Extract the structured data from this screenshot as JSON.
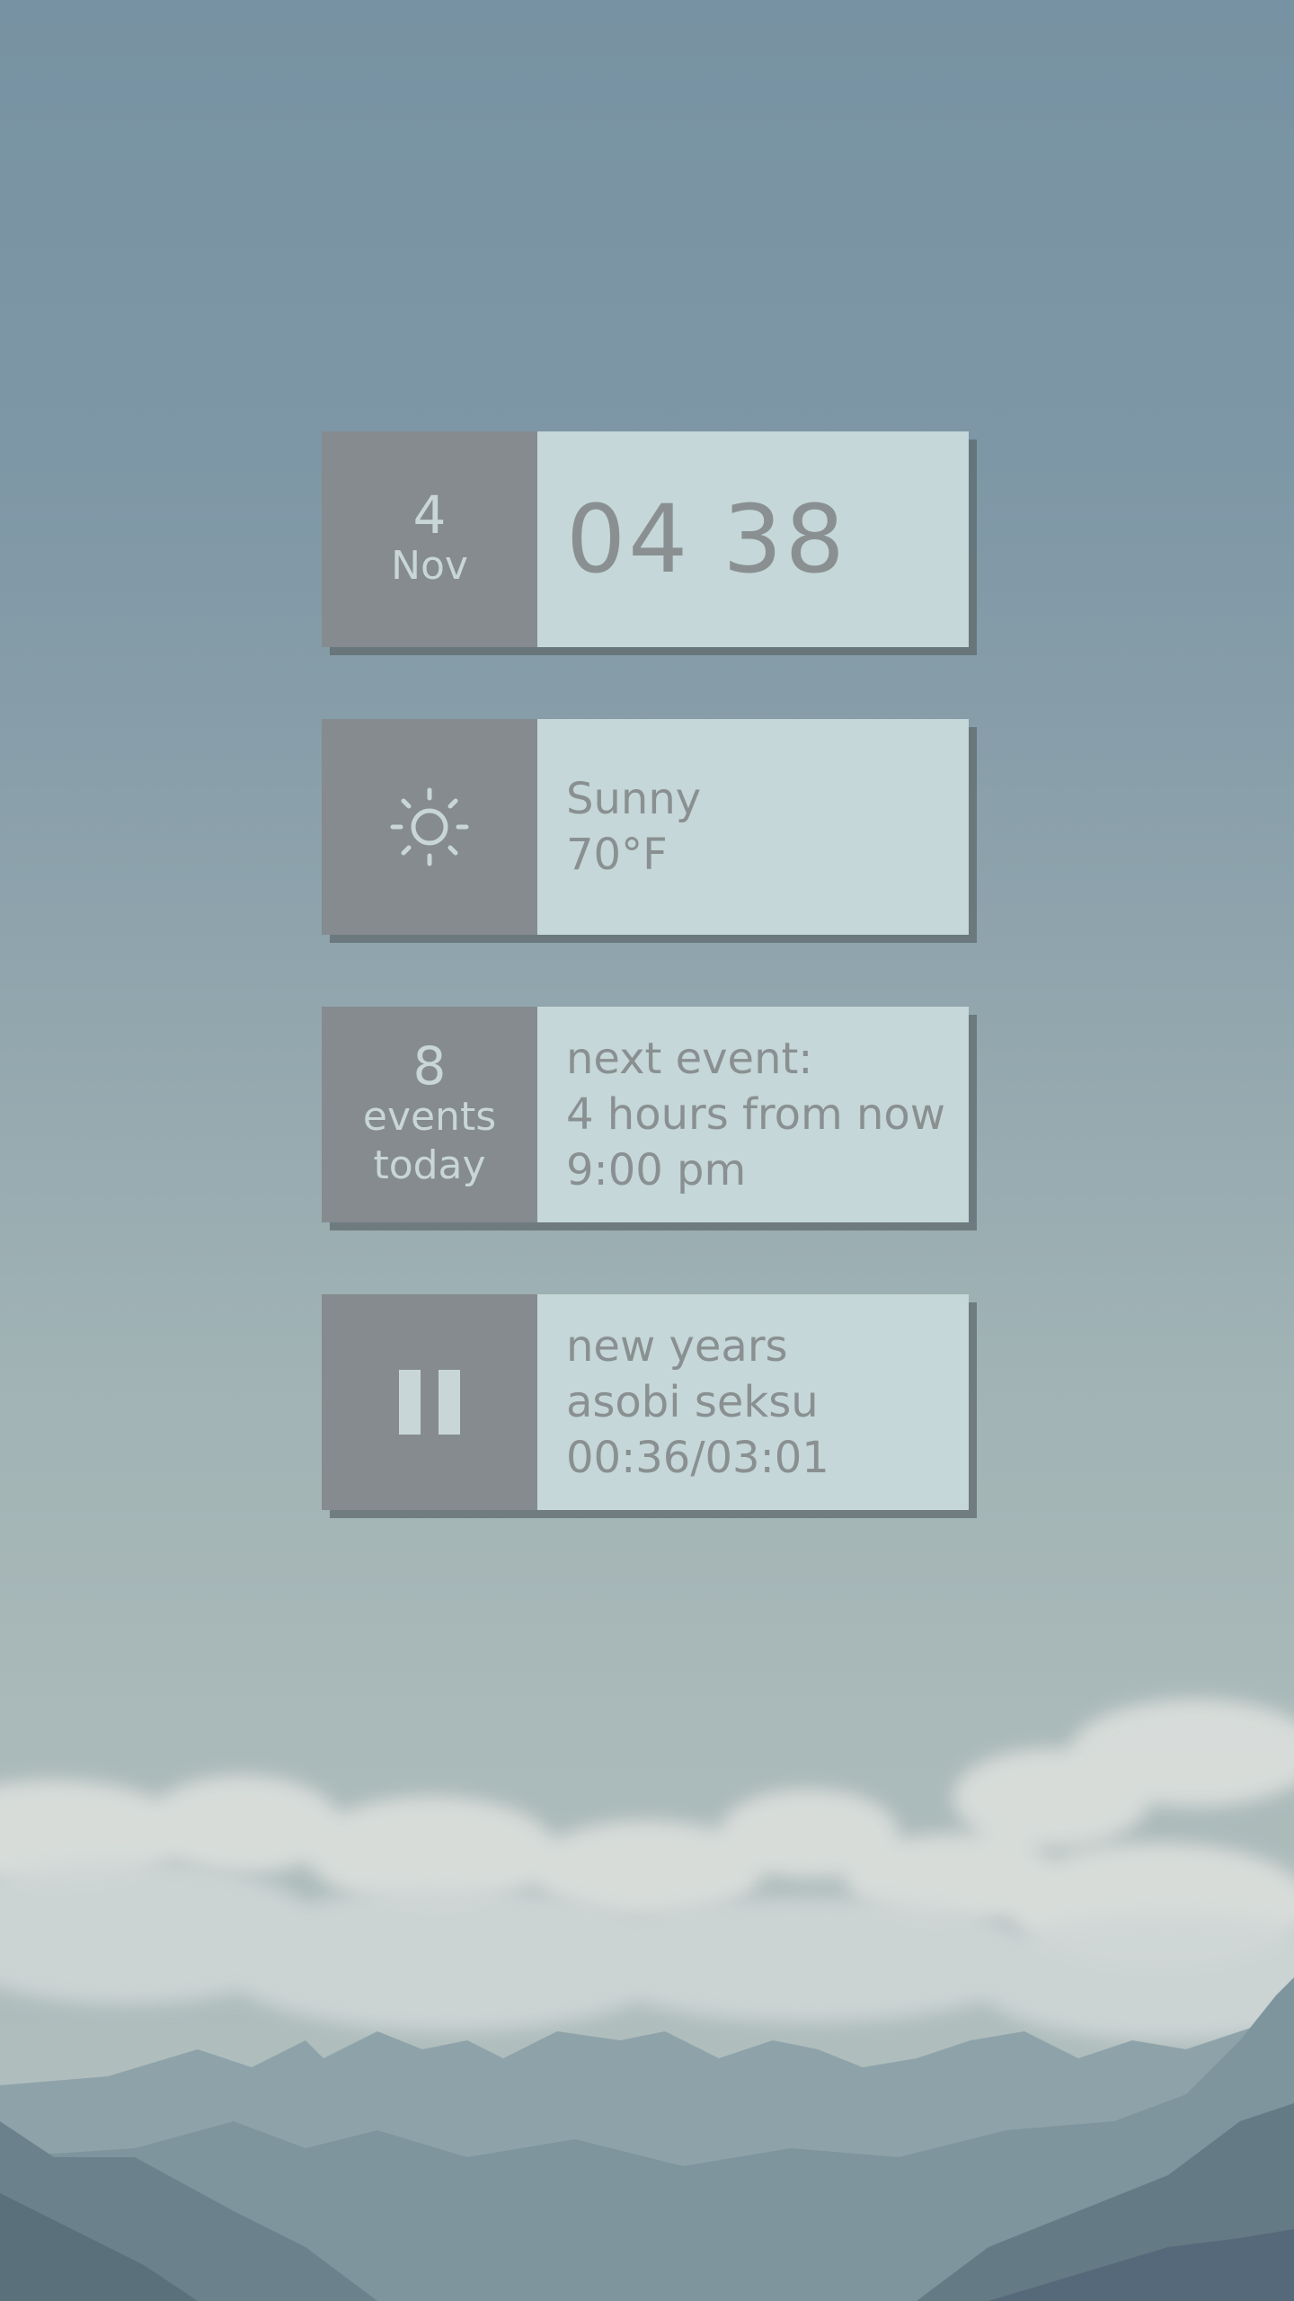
{
  "clock": {
    "day": "4",
    "month": "Nov",
    "time": "04 38"
  },
  "weather": {
    "icon": "sun-icon",
    "condition": "Sunny",
    "temperature": "70°F"
  },
  "calendar": {
    "count": "8",
    "count_label_1": "events",
    "count_label_2": "today",
    "next_label": "next event:",
    "relative_time": "4 hours from now",
    "event_time": "9:00 pm"
  },
  "music": {
    "icon": "pause-icon",
    "track": "new years",
    "artist": "asobi seksu",
    "progress": "00:36/03:01"
  },
  "colors": {
    "tile_dark": "#858b8f",
    "tile_light": "#c5d7d8",
    "text_light": "#c9d6d7",
    "text_dark": "#8a9091"
  }
}
